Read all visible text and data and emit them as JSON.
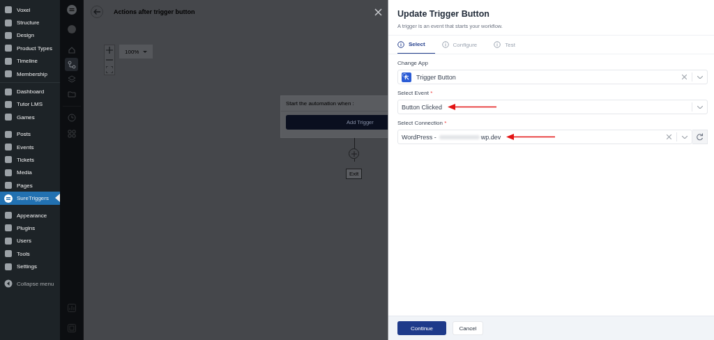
{
  "sidebar": {
    "groups": [
      [
        {
          "label": "Voxel",
          "selected": false
        },
        {
          "label": "Structure",
          "selected": false
        },
        {
          "label": "Design",
          "selected": false
        },
        {
          "label": "Product Types",
          "selected": false
        },
        {
          "label": "Timeline",
          "selected": false
        },
        {
          "label": "Membership",
          "selected": false
        }
      ],
      [
        {
          "label": "Dashboard",
          "selected": false
        },
        {
          "label": "Tutor LMS",
          "selected": false
        },
        {
          "label": "Games",
          "selected": false
        }
      ],
      [
        {
          "label": "Posts",
          "selected": false
        },
        {
          "label": "Events",
          "selected": false
        },
        {
          "label": "Tickets",
          "selected": false
        },
        {
          "label": "Media",
          "selected": false
        },
        {
          "label": "Pages",
          "selected": false
        },
        {
          "label": "SureTriggers",
          "selected": true
        }
      ],
      [
        {
          "label": "Appearance",
          "selected": false
        },
        {
          "label": "Plugins",
          "selected": false
        },
        {
          "label": "Users",
          "selected": false
        },
        {
          "label": "Tools",
          "selected": false
        },
        {
          "label": "Settings",
          "selected": false
        }
      ]
    ],
    "collapse": "Collapse menu"
  },
  "rail": {
    "items": [
      {
        "selected": false
      },
      {
        "selected": true
      },
      {
        "selected": false
      },
      {
        "selected": false
      }
    ]
  },
  "canvas": {
    "title": "Actions after trigger button",
    "zoom": "100%",
    "node": {
      "heading": "Start the automation when :",
      "button": "Add Trigger"
    },
    "exit": "Exit"
  },
  "panel": {
    "title": "Update Trigger Button",
    "subtitle": "A trigger is an event that starts your workflow.",
    "tabs": [
      {
        "label": "Select",
        "selected": true
      },
      {
        "label": "Configure",
        "selected": false
      },
      {
        "label": "Test",
        "selected": false
      }
    ],
    "fields": [
      {
        "kind": "app",
        "label": "Change App",
        "value": "Trigger Button",
        "arrow": false
      },
      {
        "kind": "select",
        "label": "Select Event",
        "required_mark": "*",
        "value": "Button Clicked",
        "arrow": true
      },
      {
        "kind": "connection",
        "label": "Select Connection",
        "required_mark": "*",
        "value": "WordPress -",
        "redacted": true,
        "value_end": "wp.dev",
        "arrow": true
      }
    ],
    "buttons": [
      {
        "label": "Continue",
        "kind": "primary"
      },
      {
        "label": "Cancel",
        "kind": "secondary"
      }
    ]
  }
}
